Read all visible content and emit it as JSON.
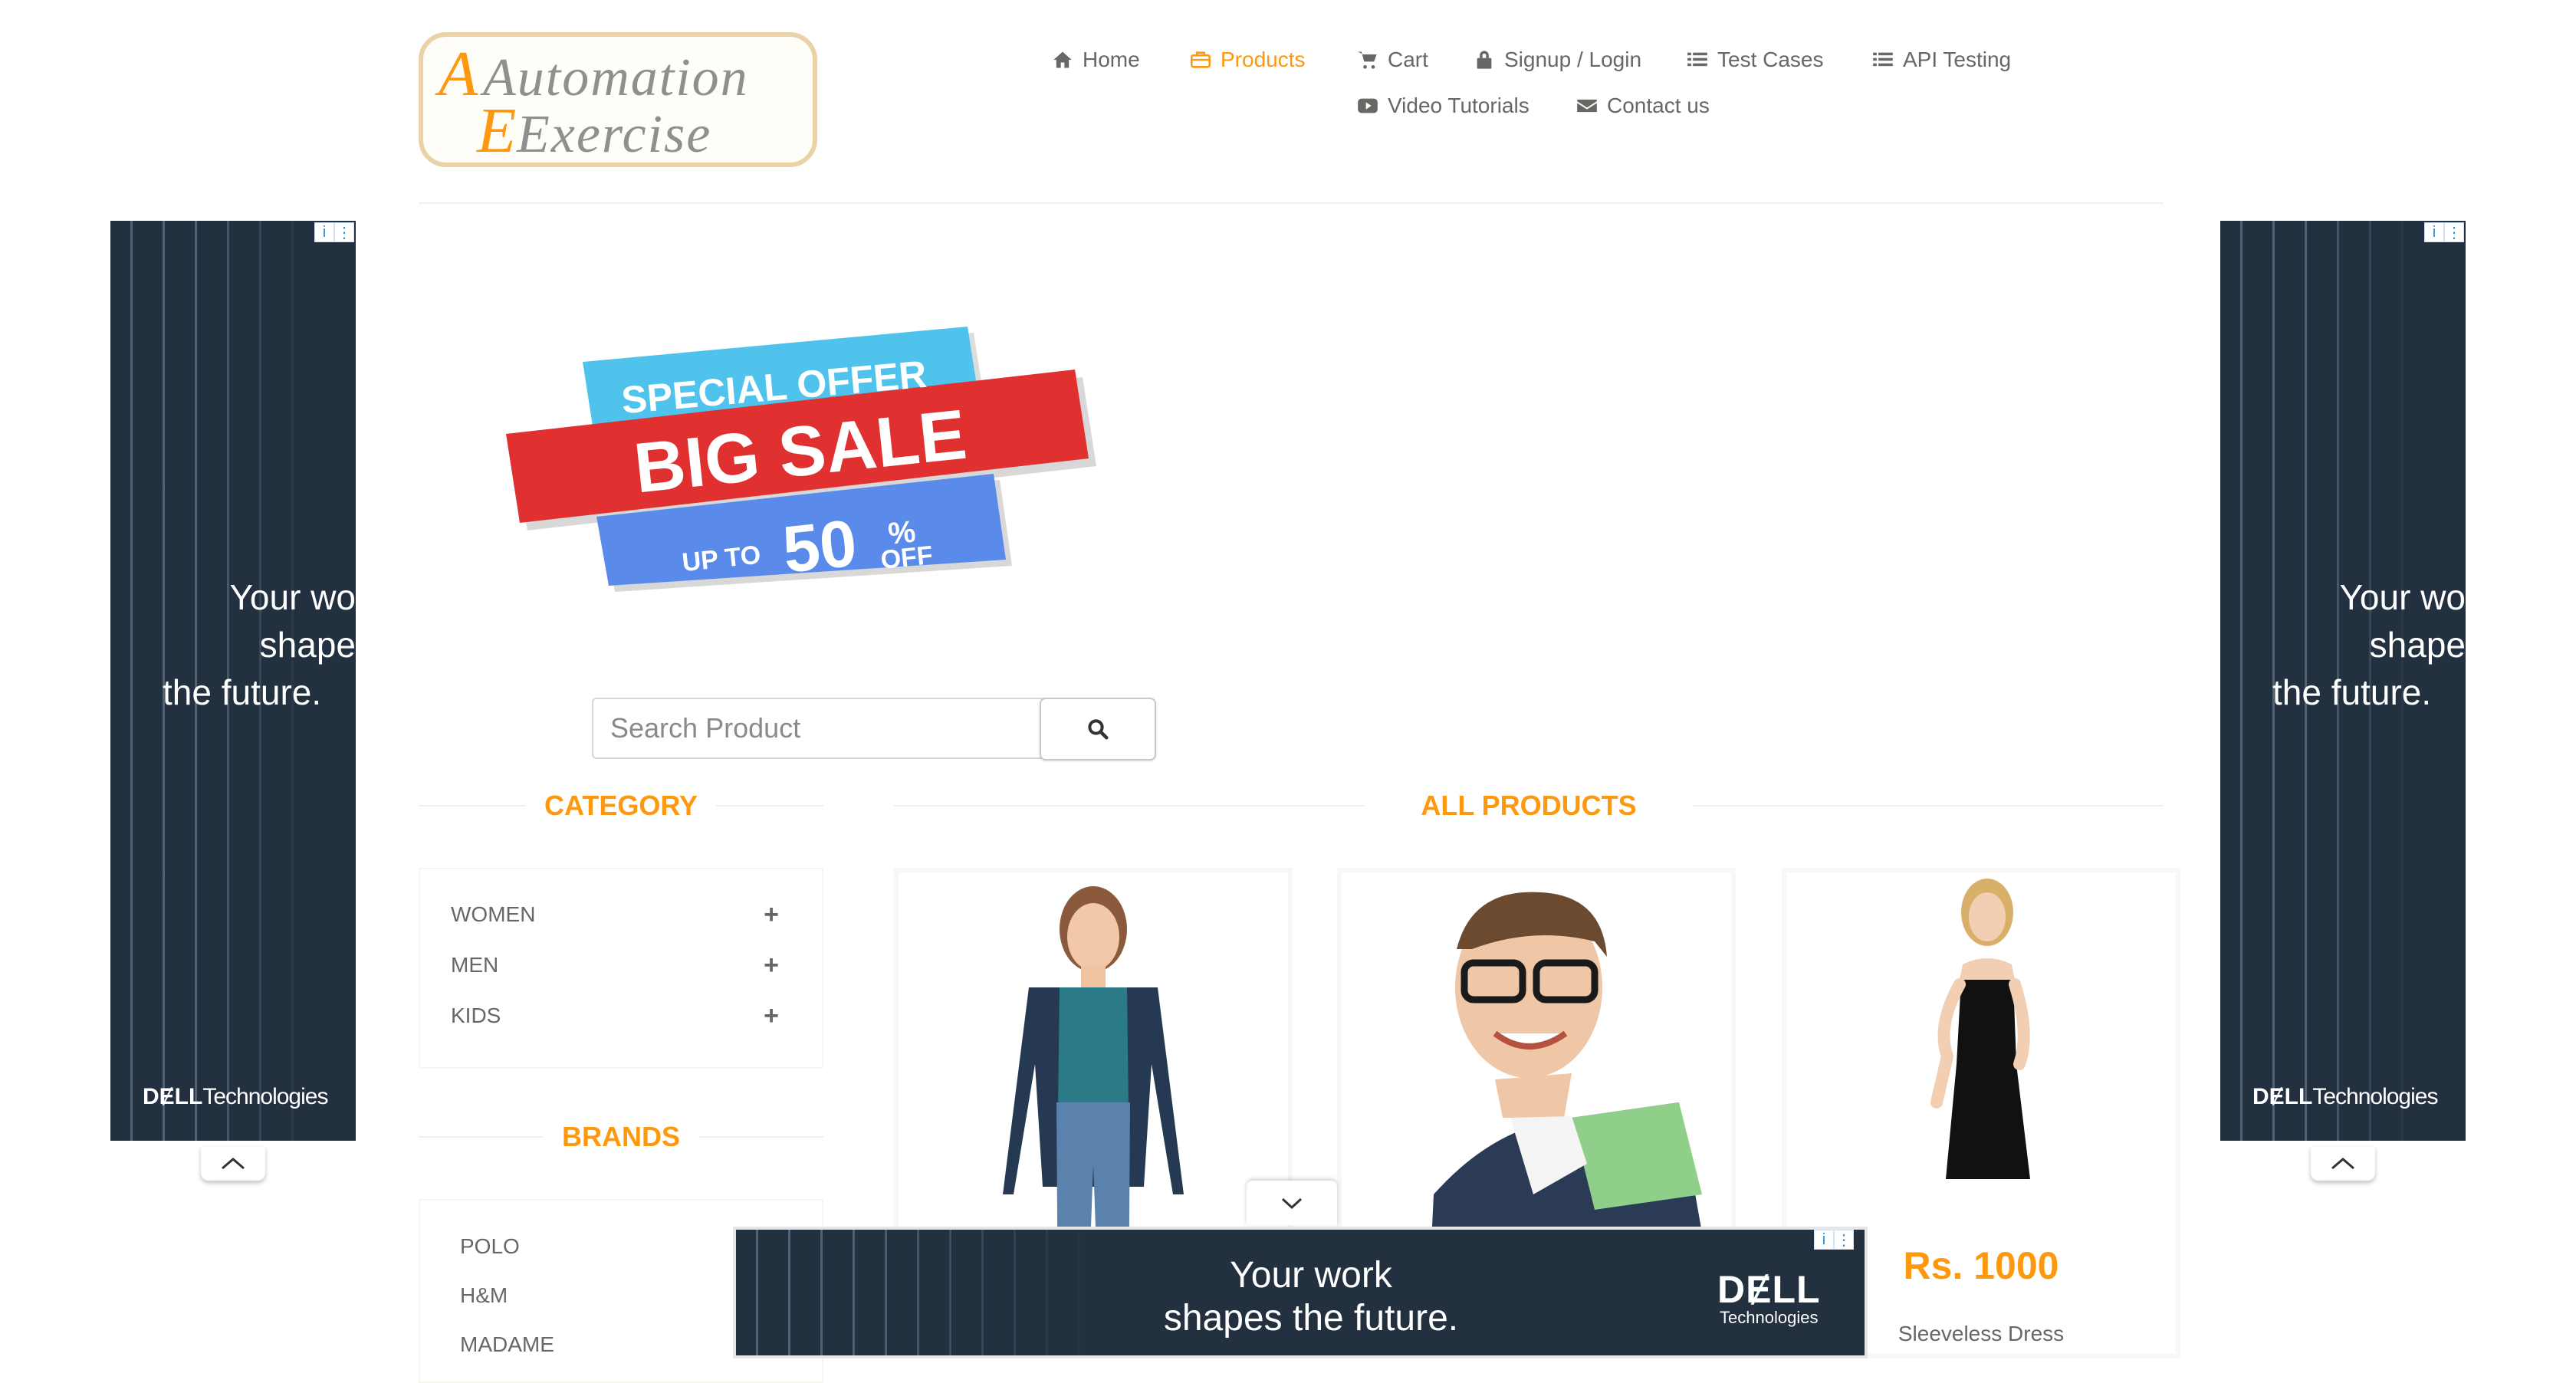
{
  "brand": {
    "logo_line1": "Automation",
    "logo_line2": "Exercise"
  },
  "nav": [
    {
      "label": "Home",
      "icon": "home-icon"
    },
    {
      "label": "Products",
      "icon": "briefcase-icon",
      "active": true
    },
    {
      "label": "Cart",
      "icon": "cart-icon"
    },
    {
      "label": "Signup / Login",
      "icon": "lock-icon"
    },
    {
      "label": "Test Cases",
      "icon": "list-icon"
    },
    {
      "label": "API Testing",
      "icon": "list-icon"
    },
    {
      "label": "Video Tutorials",
      "icon": "youtube-play-icon"
    },
    {
      "label": "Contact us",
      "icon": "envelope-icon"
    }
  ],
  "banner": {
    "line1": "SPECIAL OFFER",
    "line2": "BIG SALE",
    "up_to": "UP TO",
    "percent": "50",
    "suffix_pct": "%",
    "suffix_off": "OFF"
  },
  "search": {
    "placeholder": "Search Product",
    "value": ""
  },
  "sidebar": {
    "category_title": "CATEGORY",
    "categories": [
      {
        "label": "WOMEN",
        "toggle": "+"
      },
      {
        "label": "MEN",
        "toggle": "+"
      },
      {
        "label": "KIDS",
        "toggle": "+"
      }
    ],
    "brands_title": "BRANDS",
    "brands": [
      "POLO",
      "H&M",
      "MADAME"
    ]
  },
  "products": {
    "title": "ALL PRODUCTS",
    "items": [
      {
        "price": "",
        "name": ""
      },
      {
        "price": "",
        "name": ""
      },
      {
        "price": "Rs. 1000",
        "name": "Sleeveless Dress"
      }
    ]
  },
  "ads": {
    "side_copy_1": "Your wo",
    "side_copy_2": "shape",
    "side_copy_3": "the future.",
    "side_brand_bold": "DɆLL",
    "side_brand_rest": "Technologies",
    "bottom_copy_1": "Your work",
    "bottom_copy_2": "shapes the future.",
    "bottom_logo": "DɆLL",
    "bottom_logo_sub": "Technologies",
    "info_icon": "i",
    "menu_icon": "⋮"
  },
  "colors": {
    "accent": "#fe980f",
    "text": "#696763",
    "ad_bg": "#22303f"
  }
}
